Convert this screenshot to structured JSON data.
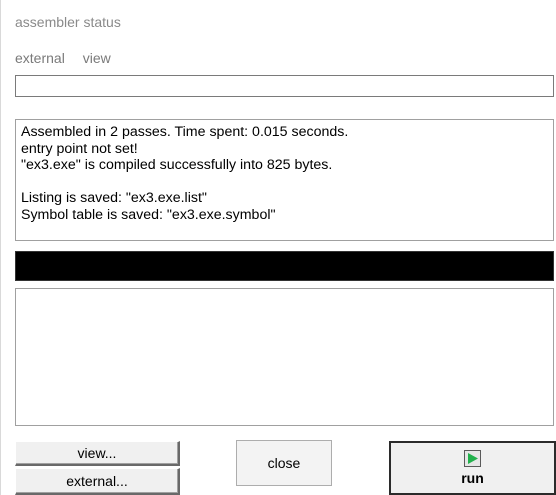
{
  "window": {
    "title": "assembler status"
  },
  "menu": {
    "items": [
      "external",
      "view"
    ]
  },
  "input": {
    "value": ""
  },
  "console": {
    "lines": [
      "Assembled in 2 passes. Time spent: 0.015 seconds.",
      "entry point not set!",
      "\"ex3.exe\" is compiled successfully into 825 bytes.",
      "",
      "Listing is saved: \"ex3.exe.list\"",
      "Symbol table is saved: \"ex3.exe.symbol\""
    ]
  },
  "buttons": {
    "view": "view...",
    "external": "external...",
    "close": "close",
    "run": "run"
  },
  "icons": {
    "run": "play-icon"
  },
  "colors": {
    "progress_bar": "#000000",
    "run_icon": "#22b14c"
  }
}
